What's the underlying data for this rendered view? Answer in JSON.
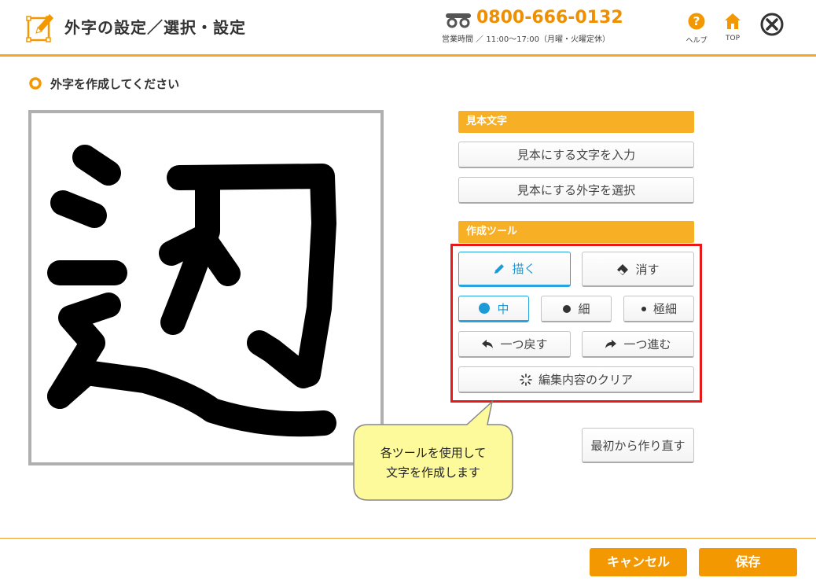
{
  "header": {
    "title": "外字の設定／選択・設定",
    "phone": "0800-666-0132",
    "hours": "営業時間 ／ 11:00〜17:00（月曜・火曜定休）",
    "help_label": "ヘルプ",
    "top_label": "TOP"
  },
  "instruction": "外字を作成してください",
  "sample_section": {
    "header": "見本文字",
    "input_text_button": "見本にする文字を入力",
    "select_gaiji_button": "見本にする外字を選択"
  },
  "tools_section": {
    "header": "作成ツール",
    "draw": "描く",
    "erase": "消す",
    "size_medium": "中",
    "size_thin": "細",
    "size_extra_thin": "極細",
    "undo": "一つ戻す",
    "redo": "一つ進む",
    "clear": "編集内容のクリア",
    "active_tool": "draw",
    "active_size": "medium"
  },
  "restart_button": "最初から作り直す",
  "tooltip": {
    "line1": "各ツールを使用して",
    "line2": "文字を作成します"
  },
  "footer": {
    "cancel": "キャンセル",
    "save": "保存"
  },
  "colors": {
    "accent": "#f39800",
    "section_header": "#f7b026",
    "active_blue": "#27a4dd",
    "highlight_red": "#e61a1a",
    "tooltip_bg": "#fdfa9c"
  }
}
